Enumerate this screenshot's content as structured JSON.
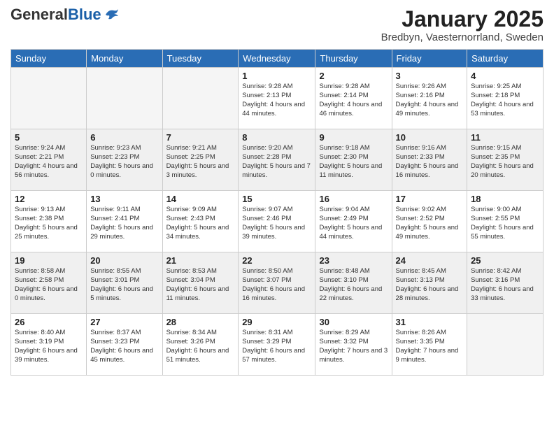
{
  "header": {
    "logo_general": "General",
    "logo_blue": "Blue",
    "month_year": "January 2025",
    "location": "Bredbyn, Vaesternorrland, Sweden"
  },
  "weekdays": [
    "Sunday",
    "Monday",
    "Tuesday",
    "Wednesday",
    "Thursday",
    "Friday",
    "Saturday"
  ],
  "weeks": [
    [
      {
        "day": "",
        "info": ""
      },
      {
        "day": "",
        "info": ""
      },
      {
        "day": "",
        "info": ""
      },
      {
        "day": "1",
        "info": "Sunrise: 9:28 AM\nSunset: 2:13 PM\nDaylight: 4 hours and 44 minutes."
      },
      {
        "day": "2",
        "info": "Sunrise: 9:28 AM\nSunset: 2:14 PM\nDaylight: 4 hours and 46 minutes."
      },
      {
        "day": "3",
        "info": "Sunrise: 9:26 AM\nSunset: 2:16 PM\nDaylight: 4 hours and 49 minutes."
      },
      {
        "day": "4",
        "info": "Sunrise: 9:25 AM\nSunset: 2:18 PM\nDaylight: 4 hours and 53 minutes."
      }
    ],
    [
      {
        "day": "5",
        "info": "Sunrise: 9:24 AM\nSunset: 2:21 PM\nDaylight: 4 hours and 56 minutes."
      },
      {
        "day": "6",
        "info": "Sunrise: 9:23 AM\nSunset: 2:23 PM\nDaylight: 5 hours and 0 minutes."
      },
      {
        "day": "7",
        "info": "Sunrise: 9:21 AM\nSunset: 2:25 PM\nDaylight: 5 hours and 3 minutes."
      },
      {
        "day": "8",
        "info": "Sunrise: 9:20 AM\nSunset: 2:28 PM\nDaylight: 5 hours and 7 minutes."
      },
      {
        "day": "9",
        "info": "Sunrise: 9:18 AM\nSunset: 2:30 PM\nDaylight: 5 hours and 11 minutes."
      },
      {
        "day": "10",
        "info": "Sunrise: 9:16 AM\nSunset: 2:33 PM\nDaylight: 5 hours and 16 minutes."
      },
      {
        "day": "11",
        "info": "Sunrise: 9:15 AM\nSunset: 2:35 PM\nDaylight: 5 hours and 20 minutes."
      }
    ],
    [
      {
        "day": "12",
        "info": "Sunrise: 9:13 AM\nSunset: 2:38 PM\nDaylight: 5 hours and 25 minutes."
      },
      {
        "day": "13",
        "info": "Sunrise: 9:11 AM\nSunset: 2:41 PM\nDaylight: 5 hours and 29 minutes."
      },
      {
        "day": "14",
        "info": "Sunrise: 9:09 AM\nSunset: 2:43 PM\nDaylight: 5 hours and 34 minutes."
      },
      {
        "day": "15",
        "info": "Sunrise: 9:07 AM\nSunset: 2:46 PM\nDaylight: 5 hours and 39 minutes."
      },
      {
        "day": "16",
        "info": "Sunrise: 9:04 AM\nSunset: 2:49 PM\nDaylight: 5 hours and 44 minutes."
      },
      {
        "day": "17",
        "info": "Sunrise: 9:02 AM\nSunset: 2:52 PM\nDaylight: 5 hours and 49 minutes."
      },
      {
        "day": "18",
        "info": "Sunrise: 9:00 AM\nSunset: 2:55 PM\nDaylight: 5 hours and 55 minutes."
      }
    ],
    [
      {
        "day": "19",
        "info": "Sunrise: 8:58 AM\nSunset: 2:58 PM\nDaylight: 6 hours and 0 minutes."
      },
      {
        "day": "20",
        "info": "Sunrise: 8:55 AM\nSunset: 3:01 PM\nDaylight: 6 hours and 5 minutes."
      },
      {
        "day": "21",
        "info": "Sunrise: 8:53 AM\nSunset: 3:04 PM\nDaylight: 6 hours and 11 minutes."
      },
      {
        "day": "22",
        "info": "Sunrise: 8:50 AM\nSunset: 3:07 PM\nDaylight: 6 hours and 16 minutes."
      },
      {
        "day": "23",
        "info": "Sunrise: 8:48 AM\nSunset: 3:10 PM\nDaylight: 6 hours and 22 minutes."
      },
      {
        "day": "24",
        "info": "Sunrise: 8:45 AM\nSunset: 3:13 PM\nDaylight: 6 hours and 28 minutes."
      },
      {
        "day": "25",
        "info": "Sunrise: 8:42 AM\nSunset: 3:16 PM\nDaylight: 6 hours and 33 minutes."
      }
    ],
    [
      {
        "day": "26",
        "info": "Sunrise: 8:40 AM\nSunset: 3:19 PM\nDaylight: 6 hours and 39 minutes."
      },
      {
        "day": "27",
        "info": "Sunrise: 8:37 AM\nSunset: 3:23 PM\nDaylight: 6 hours and 45 minutes."
      },
      {
        "day": "28",
        "info": "Sunrise: 8:34 AM\nSunset: 3:26 PM\nDaylight: 6 hours and 51 minutes."
      },
      {
        "day": "29",
        "info": "Sunrise: 8:31 AM\nSunset: 3:29 PM\nDaylight: 6 hours and 57 minutes."
      },
      {
        "day": "30",
        "info": "Sunrise: 8:29 AM\nSunset: 3:32 PM\nDaylight: 7 hours and 3 minutes."
      },
      {
        "day": "31",
        "info": "Sunrise: 8:26 AM\nSunset: 3:35 PM\nDaylight: 7 hours and 9 minutes."
      },
      {
        "day": "",
        "info": ""
      }
    ]
  ]
}
